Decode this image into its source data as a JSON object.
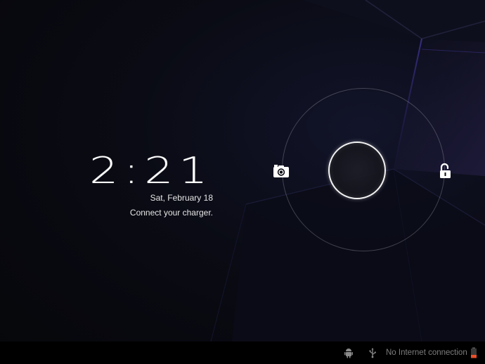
{
  "lockscreen": {
    "time": "2:21",
    "date": "Sat, February 18",
    "status": "Connect your charger.",
    "targets": {
      "left": "camera-icon",
      "right": "unlock-icon"
    }
  },
  "status_bar": {
    "icons": [
      "android-debug-icon",
      "usb-icon",
      "battery-icon"
    ],
    "network_text": "No Internet connection",
    "battery_color": "#e8502a"
  },
  "colors": {
    "background": "#06070b",
    "accent_glow": "#3a2a8a",
    "text": "#ffffff"
  }
}
